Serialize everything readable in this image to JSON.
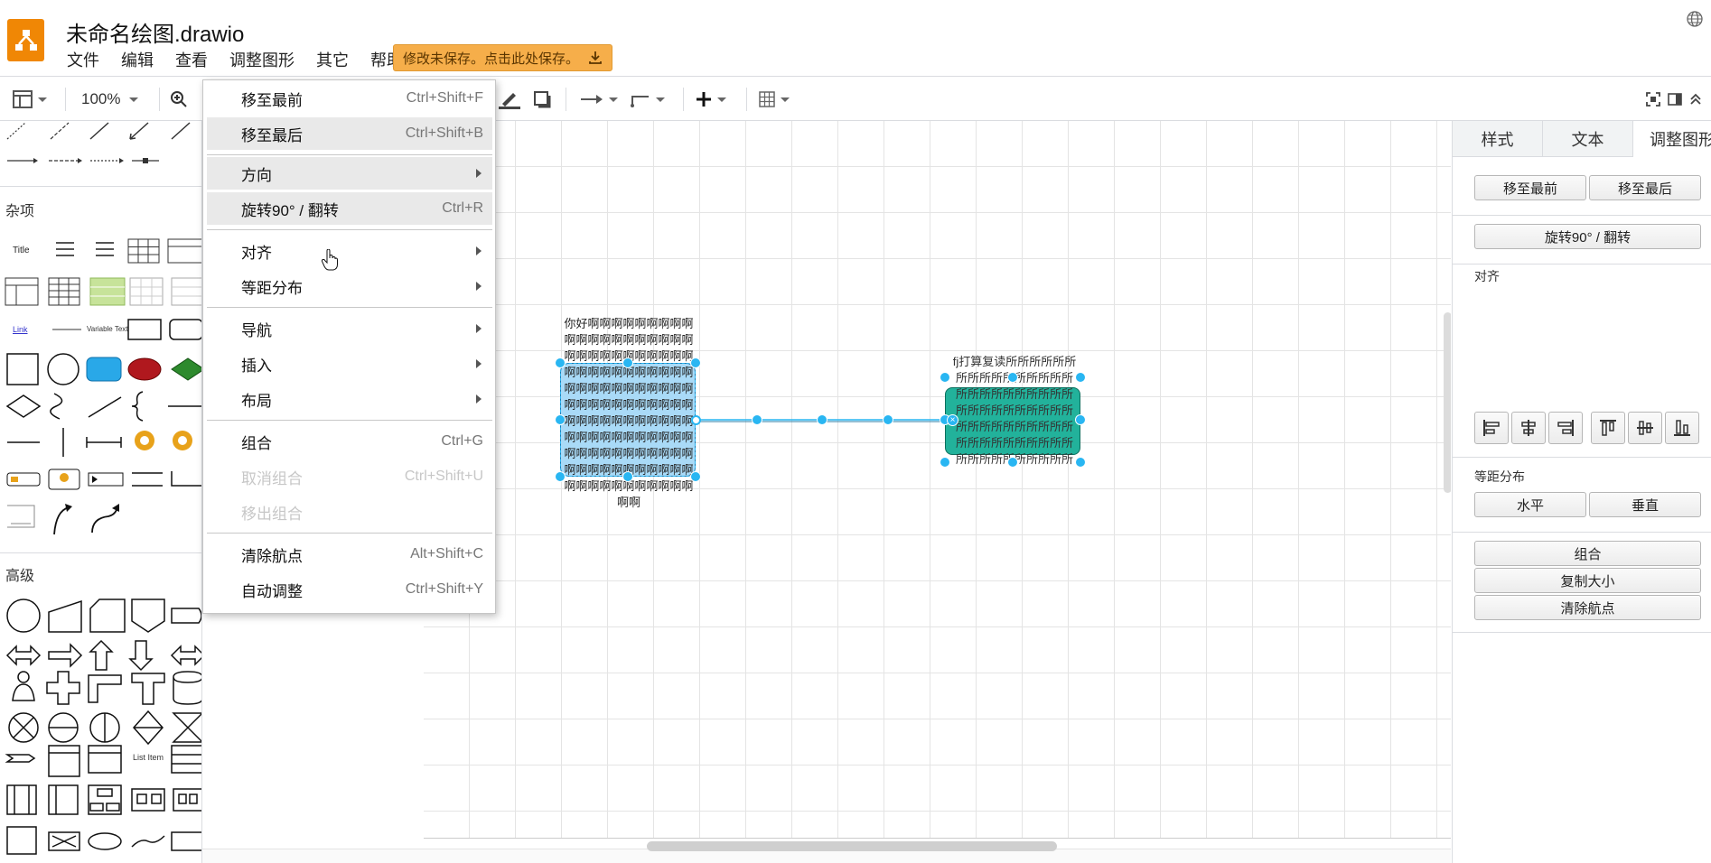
{
  "app": {
    "doc_title": "未命名绘图.drawio",
    "unsaved_notice": "修改未保存。点击此处保存。"
  },
  "menubar": [
    "文件",
    "编辑",
    "查看",
    "调整图形",
    "其它",
    "帮助"
  ],
  "toolbar": {
    "zoom": "100%"
  },
  "sidebar": {
    "sections": [
      {
        "title": "杂项"
      },
      {
        "title": "高级"
      }
    ],
    "misc_labels": {
      "title": "Title",
      "link": "Link",
      "variable_text": "Variable Text",
      "list_item": "List Item"
    }
  },
  "context_menu": {
    "items": [
      {
        "label": "移至最前",
        "shortcut": "Ctrl+Shift+F"
      },
      {
        "label": "移至最后",
        "shortcut": "Ctrl+Shift+B"
      },
      {
        "label": "方向",
        "shortcut": ""
      },
      {
        "label": "旋转90° / 翻转",
        "shortcut": "Ctrl+R"
      },
      {
        "label": "对齐",
        "shortcut": ""
      },
      {
        "label": "等距分布",
        "shortcut": ""
      },
      {
        "label": "导航",
        "shortcut": ""
      },
      {
        "label": "插入",
        "shortcut": ""
      },
      {
        "label": "布局",
        "shortcut": ""
      },
      {
        "label": "组合",
        "shortcut": "Ctrl+G"
      },
      {
        "label": "取消组合",
        "shortcut": "Ctrl+Shift+U"
      },
      {
        "label": "移出组合",
        "shortcut": ""
      },
      {
        "label": "清除航点",
        "shortcut": "Alt+Shift+C"
      },
      {
        "label": "自动调整",
        "shortcut": "Ctrl+Shift+Y"
      }
    ]
  },
  "canvas": {
    "left_shape_text": "你好啊啊啊啊啊啊啊啊啊啊啊啊啊啊啊啊啊啊啊啊啊啊啊啊啊啊啊啊啊啊啊啊啊啊啊啊啊啊啊啊啊啊啊啊啊啊啊啊啊啊啊啊啊啊啊啊啊啊啊啊啊啊啊啊啊啊啊啊啊啊啊啊啊啊啊啊啊啊啊啊啊啊啊啊啊啊啊啊啊啊啊啊啊啊啊啊啊啊啊啊啊啊啊啊啊啊啊啊啊啊啊啊啊啊啊啊啊啊啊啊啊",
    "right_shape_text": "fj打算复读所所所所所所所所所所所所所所所所所所所所所所所所所所所所所所所所所所所所所所所所所所所所所所所所所所所所所所所所所所所所所所所所所所",
    "left_fill": "#a9daf7",
    "right_fill": "#22b29b",
    "selection_color": "#29b6f2"
  },
  "right_panel": {
    "tabs": [
      "样式",
      "文本",
      "调整图形"
    ],
    "to_front": "移至最前",
    "to_back": "移至最后",
    "rotate": "旋转90° / 翻转",
    "align_label": "对齐",
    "distribute_label": "等距分布",
    "horizontal": "水平",
    "vertical": "垂直",
    "group": "组合",
    "copy_size": "复制大小",
    "clear_waypoints": "清除航点"
  },
  "colors": {
    "brand": "#f08705",
    "unsaved_bg": "#f6ae4a",
    "menu_highlight": "#e9e9e9"
  }
}
